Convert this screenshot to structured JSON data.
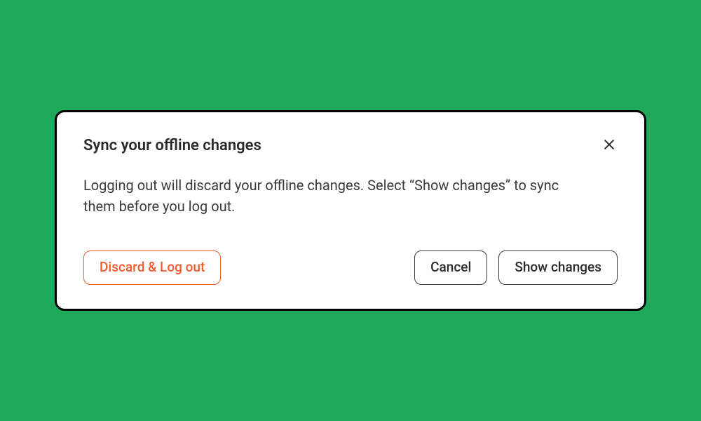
{
  "dialog": {
    "title": "Sync your offline changes",
    "body": "Logging out will discard your offline changes. Select “Show changes” to sync them before you log out.",
    "buttons": {
      "discard": "Discard & Log out",
      "cancel": "Cancel",
      "show": "Show changes"
    }
  },
  "colors": {
    "background": "#1eaa5a",
    "danger": "#f25c2e",
    "text": "#2a2a2a"
  }
}
